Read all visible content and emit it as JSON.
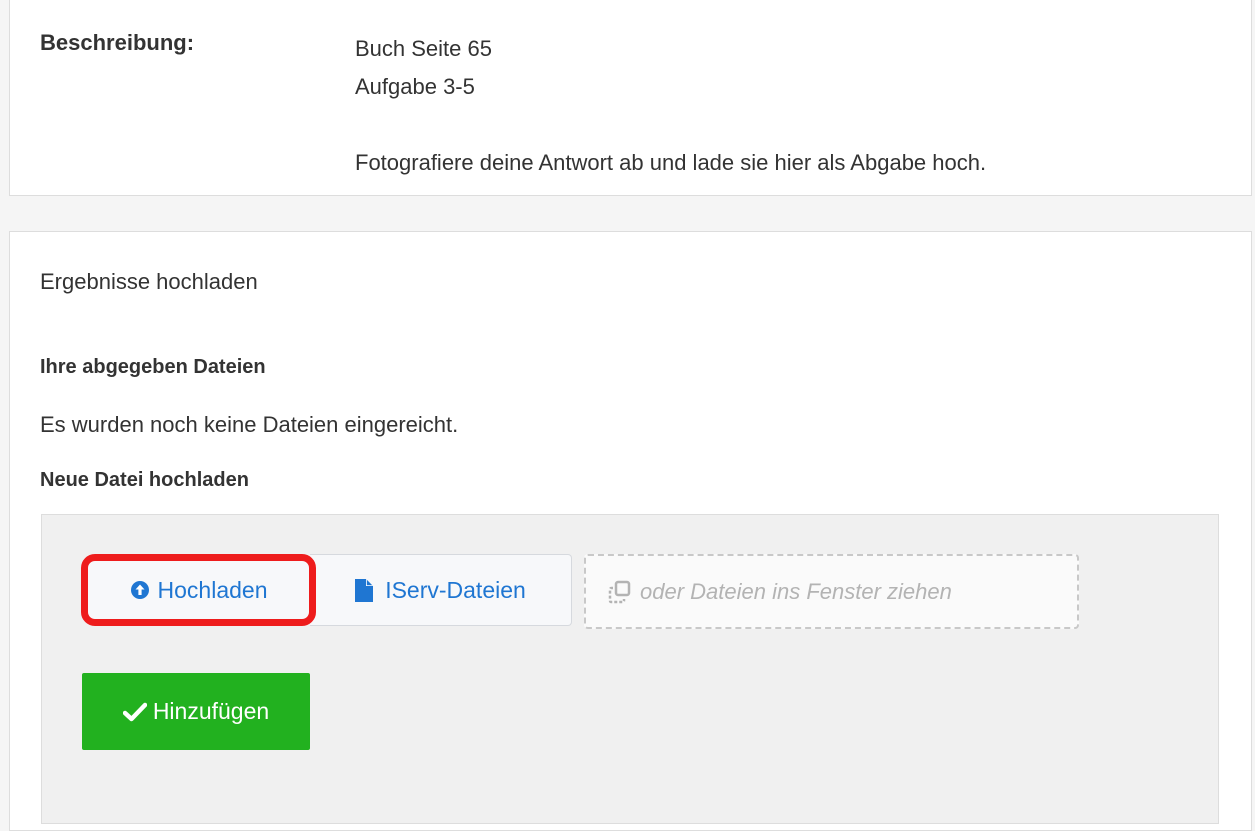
{
  "description": {
    "label": "Beschreibung:",
    "line1": "Buch Seite 65",
    "line2": "Aufgabe 3-5",
    "line3": "Fotografiere deine Antwort ab und lade sie hier als Abgabe hoch."
  },
  "upload_section": {
    "title": "Ergebnisse hochladen",
    "submitted_heading": "Ihre abgegeben Dateien",
    "no_files_text": "Es wurden noch keine Dateien eingereicht.",
    "new_file_heading": "Neue Datei hochladen",
    "upload_button": "Hochladen",
    "iserv_button": "IServ-Dateien",
    "dropzone_text": "oder Dateien ins Fenster ziehen",
    "add_button": "Hinzufügen"
  },
  "icons": {
    "upload": "arrow-circle-up-icon",
    "file": "file-icon",
    "copy": "copy-icon",
    "check": "check-icon"
  },
  "colors": {
    "link_blue": "#1f76d2",
    "highlight_red": "#ee1c1c",
    "success_green": "#22b11f"
  }
}
